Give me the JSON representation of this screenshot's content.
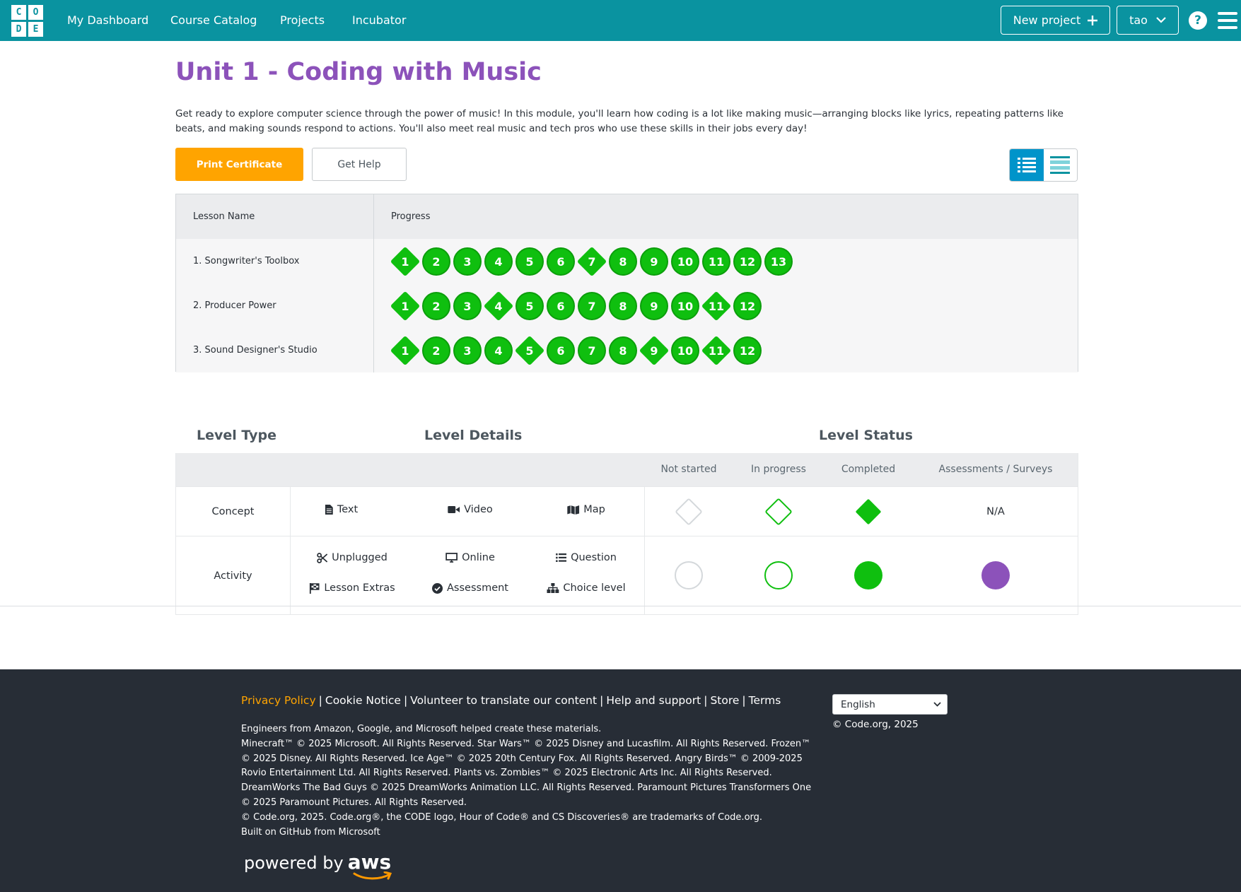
{
  "header": {
    "logo_letters": [
      "C",
      "O",
      "D",
      "E"
    ],
    "nav": [
      "My Dashboard",
      "Course Catalog",
      "Projects",
      "Incubator"
    ],
    "new_project_label": "New project",
    "user_label": "tao",
    "help_label": "?"
  },
  "unit": {
    "title": "Unit 1 - Coding with Music",
    "description": "Get ready to explore computer science through the power of music! In this module, you'll learn how coding is a lot like making music—arranging blocks like lyrics, repeating patterns like beats, and making sounds respond to actions. You'll also meet real music and tech pros who use these skills in their jobs every day!",
    "print_certificate_label": "Print Certificate",
    "get_help_label": "Get Help"
  },
  "progress_table": {
    "headers": [
      "Lesson Name",
      "Progress"
    ],
    "lessons": [
      {
        "name": "1. Songwriter's Toolbox",
        "levels": [
          {
            "n": "1",
            "shape": "diamond"
          },
          {
            "n": "2",
            "shape": "circle"
          },
          {
            "n": "3",
            "shape": "circle"
          },
          {
            "n": "4",
            "shape": "circle"
          },
          {
            "n": "5",
            "shape": "circle"
          },
          {
            "n": "6",
            "shape": "circle"
          },
          {
            "n": "7",
            "shape": "diamond"
          },
          {
            "n": "8",
            "shape": "circle"
          },
          {
            "n": "9",
            "shape": "circle"
          },
          {
            "n": "10",
            "shape": "circle"
          },
          {
            "n": "11",
            "shape": "circle"
          },
          {
            "n": "12",
            "shape": "circle"
          },
          {
            "n": "13",
            "shape": "circle"
          }
        ]
      },
      {
        "name": "2. Producer Power",
        "levels": [
          {
            "n": "1",
            "shape": "diamond"
          },
          {
            "n": "2",
            "shape": "circle"
          },
          {
            "n": "3",
            "shape": "circle"
          },
          {
            "n": "4",
            "shape": "diamond"
          },
          {
            "n": "5",
            "shape": "circle"
          },
          {
            "n": "6",
            "shape": "circle"
          },
          {
            "n": "7",
            "shape": "circle"
          },
          {
            "n": "8",
            "shape": "circle"
          },
          {
            "n": "9",
            "shape": "circle"
          },
          {
            "n": "10",
            "shape": "circle"
          },
          {
            "n": "11",
            "shape": "diamond"
          },
          {
            "n": "12",
            "shape": "circle"
          }
        ]
      },
      {
        "name": "3. Sound Designer's Studio",
        "levels": [
          {
            "n": "1",
            "shape": "diamond"
          },
          {
            "n": "2",
            "shape": "circle"
          },
          {
            "n": "3",
            "shape": "circle"
          },
          {
            "n": "4",
            "shape": "circle"
          },
          {
            "n": "5",
            "shape": "diamond"
          },
          {
            "n": "6",
            "shape": "circle"
          },
          {
            "n": "7",
            "shape": "circle"
          },
          {
            "n": "8",
            "shape": "circle"
          },
          {
            "n": "9",
            "shape": "diamond"
          },
          {
            "n": "10",
            "shape": "circle"
          },
          {
            "n": "11",
            "shape": "diamond"
          },
          {
            "n": "12",
            "shape": "circle"
          }
        ]
      }
    ]
  },
  "key": {
    "level_type_heading": "Level Type",
    "level_details_heading": "Level Details",
    "level_status_heading": "Level Status",
    "status_headers": [
      "Not started",
      "In progress",
      "Completed",
      "Assessments / Surveys"
    ],
    "concept": {
      "label": "Concept",
      "details": [
        "Text",
        "Video",
        "Map"
      ],
      "na_label": "N/A"
    },
    "activity": {
      "label": "Activity",
      "details": [
        "Unplugged",
        "Online",
        "Question",
        "Lesson Extras",
        "Assessment",
        "Choice level"
      ]
    },
    "colors": {
      "completed": "#0fbf0f",
      "assessment": "#8c52ba",
      "not_started": "#d4d8db"
    }
  },
  "footer": {
    "links": [
      "Privacy Policy",
      "Cookie Notice",
      "Volunteer to translate our content",
      "Help and support",
      "Store",
      "Terms"
    ],
    "lines": [
      "Engineers from Amazon, Google, and Microsoft helped create these materials.",
      "Minecraft™ © 2025 Microsoft. All Rights Reserved. Star Wars™ © 2025 Disney and Lucasfilm. All Rights Reserved. Frozen™ © 2025 Disney. All Rights Reserved. Ice Age™ © 2025 20th Century Fox. All Rights Reserved. Angry Birds™ © 2009-2025 Rovio Entertainment Ltd. All Rights Reserved. Plants vs. Zombies™ © 2025 Electronic Arts Inc. All Rights Reserved. DreamWorks The Bad Guys © 2025 DreamWorks Animation LLC. All Rights Reserved. Paramount Pictures Transformers One © 2025 Paramount Pictures. All Rights Reserved.",
      "© Code.org, 2025. Code.org®, the CODE logo, Hour of Code® and CS Discoveries® are trademarks of Code.org.",
      "Built on GitHub from Microsoft"
    ],
    "language": "English",
    "copyright": "© Code.org, 2025",
    "powered_by": "powered by",
    "aws": "aws"
  }
}
